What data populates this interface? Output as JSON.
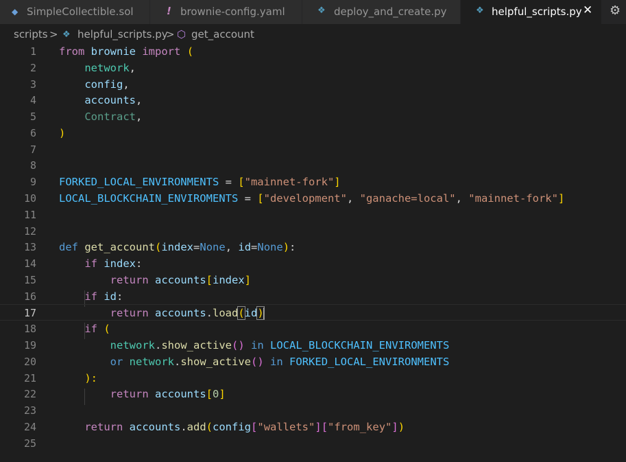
{
  "tabs": [
    {
      "label": "SimpleCollectible.sol",
      "icon": "solidity-icon",
      "active": false
    },
    {
      "label": "brownie-config.yaml",
      "icon": "yaml-exclamation-icon",
      "active": false
    },
    {
      "label": "deploy_and_create.py",
      "icon": "python-icon",
      "active": false
    },
    {
      "label": "helpful_scripts.py",
      "icon": "python-icon",
      "active": true
    }
  ],
  "tab_glyphs": {
    "solidity": "◆",
    "yaml": "!",
    "python": "❖",
    "close": "✕",
    "gear": "⚙"
  },
  "breadcrumb": {
    "folder": "scripts",
    "sep": ">",
    "file": "helpful_scripts.py",
    "symbol": "get_account",
    "symbol_glyph": "⬡"
  },
  "editor": {
    "current_line": 17,
    "lines": [
      {
        "n": "1"
      },
      {
        "n": "2"
      },
      {
        "n": "3"
      },
      {
        "n": "4"
      },
      {
        "n": "5"
      },
      {
        "n": "6"
      },
      {
        "n": "7"
      },
      {
        "n": "8"
      },
      {
        "n": "9"
      },
      {
        "n": "10"
      },
      {
        "n": "11"
      },
      {
        "n": "12"
      },
      {
        "n": "13"
      },
      {
        "n": "14"
      },
      {
        "n": "15"
      },
      {
        "n": "16"
      },
      {
        "n": "17"
      },
      {
        "n": "18"
      },
      {
        "n": "19"
      },
      {
        "n": "20"
      },
      {
        "n": "21"
      },
      {
        "n": "22"
      },
      {
        "n": "23"
      },
      {
        "n": "24"
      },
      {
        "n": "25"
      }
    ],
    "tokens": {
      "from": "from",
      "brownie": "brownie",
      "import": "import",
      "lparen": "(",
      "rparen": ")",
      "network": "network",
      "config": "config",
      "accounts": "accounts",
      "Contract": "Contract",
      "comma": ",",
      "forked": "FORKED_LOCAL_ENVIRONMENTS",
      "eq": " = ",
      "lbr": "[",
      "rbr": "]",
      "mainnet_fork": "\"mainnet-fork\"",
      "local": "LOCAL_BLOCKCHAIN_ENVIROMENTS",
      "development": "\"development\"",
      "ganache": "\"ganache=local\"",
      "csp": ", ",
      "def": "def",
      "get_account": "get_account",
      "index": "index",
      "assign": "=",
      "None": "None",
      "id": "id",
      "colon": ":",
      "rparen_colon": "):",
      "if": "if",
      "return": "return",
      "dot": ".",
      "load": "load",
      "or": "or",
      "show_active": "show_active",
      "in": "in",
      "call": "()",
      "zero": "0",
      "add": "add",
      "wallets": "\"wallets\"",
      "from_key": "\"from_key\""
    }
  }
}
